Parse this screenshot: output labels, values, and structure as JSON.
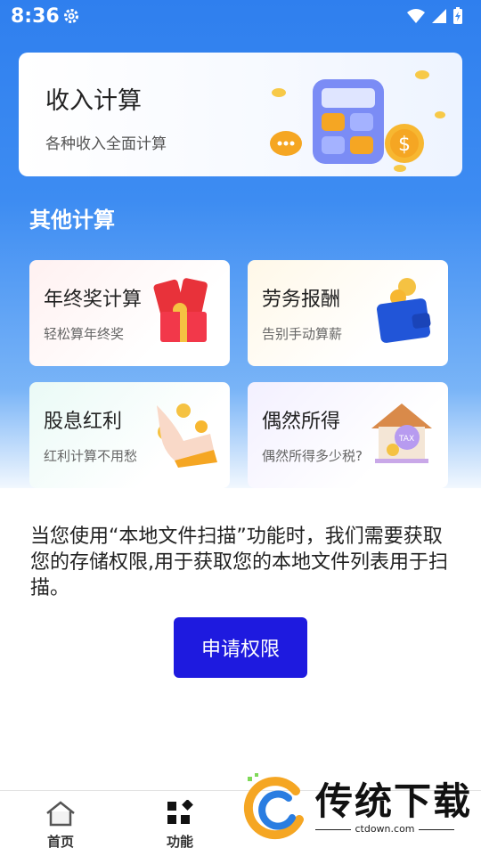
{
  "status_bar": {
    "time": "8:36"
  },
  "main_card": {
    "title": "收入计算",
    "subtitle": "各种收入全面计算"
  },
  "section_title": "其他计算",
  "cards": [
    {
      "title": "年终奖计算",
      "subtitle": "轻松算年终奖",
      "icon": "red-envelope-gift-icon"
    },
    {
      "title": "劳务报酬",
      "subtitle": "告别手动算薪",
      "icon": "wallet-coins-icon"
    },
    {
      "title": "股息红利",
      "subtitle": "红利计算不用愁",
      "icon": "hand-coins-icon"
    },
    {
      "title": "偶然所得",
      "subtitle": "偶然所得多少税?",
      "icon": "tax-house-icon"
    }
  ],
  "permission": {
    "message": "当您使用“本地文件扫描”功能时，我们需要获取您的存储权限,用于获取您的本地文件列表用于扫描。",
    "button": "申请权限"
  },
  "tabbar": {
    "home": "首页",
    "features": "功能"
  },
  "watermark": {
    "brand": "传统下载",
    "url": "ctdown.com"
  },
  "colors": {
    "primary_blue": "#2f7fee",
    "button": "#1e1adf"
  }
}
